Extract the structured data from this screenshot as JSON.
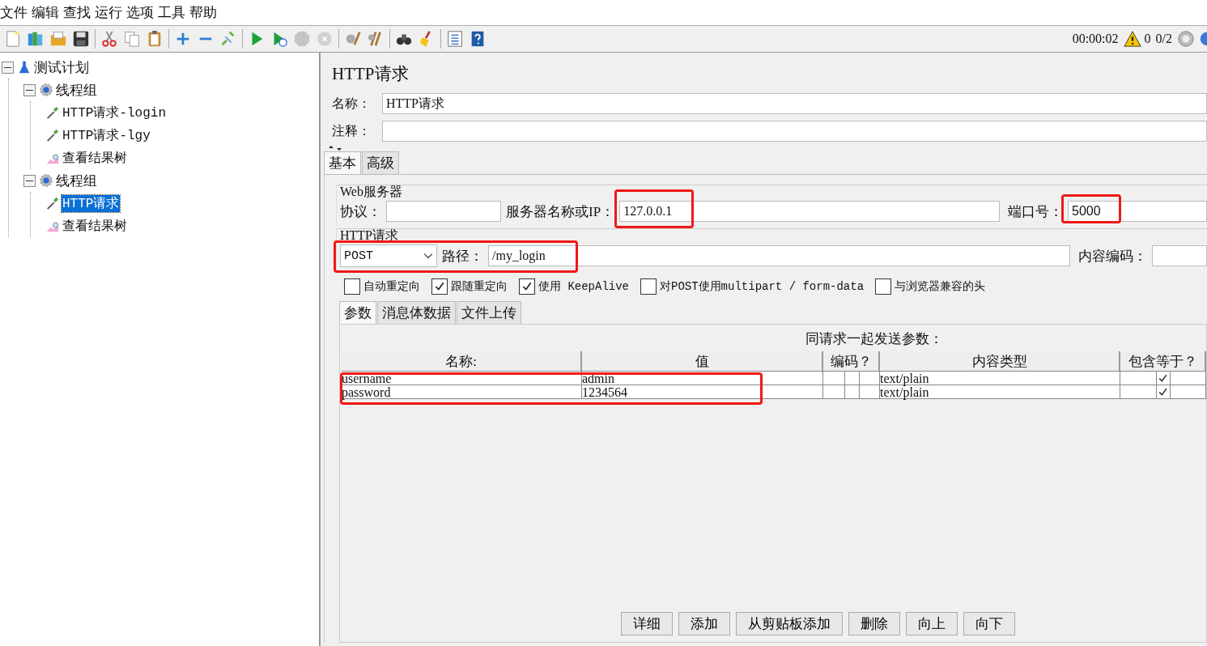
{
  "menu": [
    "文件",
    "编辑",
    "查找",
    "运行",
    "选项",
    "工具",
    "帮助"
  ],
  "toolbar": [
    {
      "kind": "new",
      "disabled": false
    },
    {
      "kind": "templates",
      "disabled": false
    },
    {
      "kind": "open",
      "disabled": false
    },
    {
      "kind": "save",
      "disabled": false
    },
    {
      "kind": "sep"
    },
    {
      "kind": "cut",
      "disabled": false
    },
    {
      "kind": "copy",
      "disabled": false
    },
    {
      "kind": "paste",
      "disabled": false
    },
    {
      "kind": "sep"
    },
    {
      "kind": "expand",
      "disabled": false
    },
    {
      "kind": "collapse",
      "disabled": false
    },
    {
      "kind": "toggle",
      "disabled": false
    },
    {
      "kind": "sep"
    },
    {
      "kind": "start",
      "disabled": false
    },
    {
      "kind": "start-nopause",
      "disabled": false
    },
    {
      "kind": "stop",
      "disabled": true
    },
    {
      "kind": "shutdown",
      "disabled": true
    },
    {
      "kind": "sep"
    },
    {
      "kind": "clear",
      "disabled": false
    },
    {
      "kind": "clear-all",
      "disabled": false
    },
    {
      "kind": "sep"
    },
    {
      "kind": "search",
      "disabled": false
    },
    {
      "kind": "reset-search",
      "disabled": false
    },
    {
      "kind": "sep"
    },
    {
      "kind": "functions",
      "disabled": false
    },
    {
      "kind": "help",
      "disabled": false
    }
  ],
  "status": {
    "elapsed": "00:00:02",
    "warnings": "0",
    "threads": "0/2"
  },
  "tree": [
    {
      "label": "测试计划",
      "kind": "plan",
      "selected": false,
      "expanded": true,
      "children": [
        {
          "label": "线程组",
          "kind": "group",
          "selected": false,
          "expanded": true,
          "children": [
            {
              "label": "HTTP请求-login",
              "kind": "sampler",
              "selected": false
            },
            {
              "label": "HTTP请求-lgy",
              "kind": "sampler",
              "selected": false
            },
            {
              "label": "查看结果树",
              "kind": "listener",
              "selected": false
            }
          ]
        },
        {
          "label": "线程组",
          "kind": "group",
          "selected": false,
          "expanded": true,
          "children": [
            {
              "label": "HTTP请求",
              "kind": "sampler",
              "selected": true
            },
            {
              "label": "查看结果树",
              "kind": "listener",
              "selected": false
            }
          ]
        }
      ]
    }
  ],
  "panel": {
    "title": "HTTP请求",
    "name_label": "名称：",
    "name": "HTTP请求",
    "comment_label": "注释：",
    "tabs": [
      {
        "label": "基本",
        "selected": true
      },
      {
        "label": "高级",
        "selected": false
      }
    ],
    "web_server": {
      "legend": "Web服务器",
      "protocol_label": "协议：",
      "server_label": "服务器名称或IP：",
      "server": "127.0.0.1",
      "server_highlighted": true,
      "port_label": "端口号：",
      "port": "5000",
      "port_highlighted": true
    },
    "http_request": {
      "legend": "HTTP请求",
      "method": "POST",
      "path_label": "路径：",
      "path": "/my_login",
      "highlighted": true,
      "encoding_label": "内容编码："
    },
    "options": [
      {
        "label": "自动重定向",
        "checked": false
      },
      {
        "label": "跟随重定向",
        "checked": true
      },
      {
        "label": "使用 KeepAlive",
        "checked": true
      },
      {
        "label": "对POST使用multipart / form-data",
        "checked": false
      },
      {
        "label": "与浏览器兼容的头",
        "checked": false
      }
    ],
    "sub_tabs": [
      {
        "label": "参数",
        "selected": true
      },
      {
        "label": "消息体数据",
        "selected": false
      },
      {
        "label": "文件上传",
        "selected": false
      }
    ],
    "params_caption": "同请求一起发送参数：",
    "columns": [
      "名称:",
      "值",
      "编码？",
      "内容类型",
      "包含等于？"
    ],
    "params_highlighted": true,
    "rows": [
      {
        "name": "username",
        "value": "admin",
        "encode": false,
        "content_type": "text/plain",
        "include_equals": true
      },
      {
        "name": "password",
        "value": "1234564",
        "encode": false,
        "content_type": "text/plain",
        "include_equals": true
      }
    ],
    "buttons": [
      "详细",
      "添加",
      "从剪贴板添加",
      "删除",
      "向上",
      "向下"
    ]
  }
}
